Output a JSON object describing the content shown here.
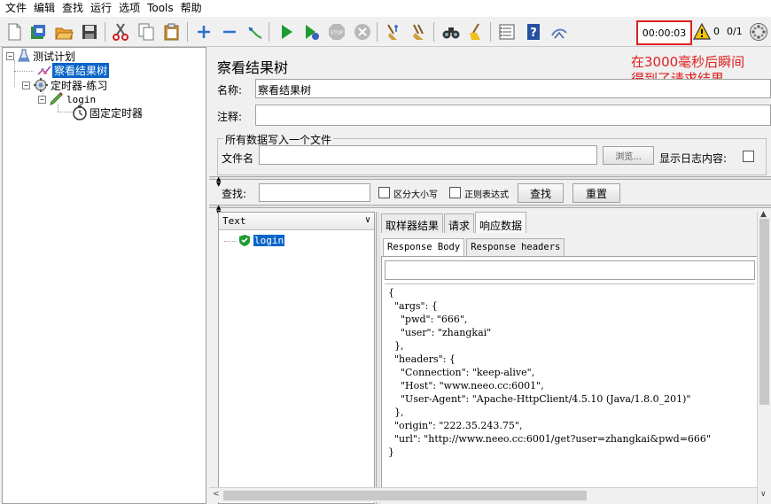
{
  "menu": [
    "文件",
    "编辑",
    "查找",
    "运行",
    "选项",
    "Tools",
    "帮助"
  ],
  "status": {
    "elapsed": "00:00:03",
    "error_count": "0",
    "threads": "0/1"
  },
  "tree": {
    "root": "测试计划",
    "listener": "察看结果树",
    "controller": "定时器-练习",
    "sampler": "login",
    "timer": "固定定时器"
  },
  "annotation": [
    "在3000毫秒后瞬间",
    "得到了请求结果"
  ],
  "panel": {
    "title": "察看结果树",
    "name_label": "名称:",
    "name_value": "察看结果树",
    "comment_label": "注释:",
    "comment_value": "",
    "file_group_title": "所有数据写入一个文件",
    "filename_label": "文件名",
    "filename_value": "",
    "browse_label": "浏览...",
    "log_label": "显示日志内容:",
    "search_label": "查找:",
    "search_value": "",
    "case_label": "区分大小写",
    "regex_label": "正则表达式",
    "find_button": "查找",
    "reset_button": "重置"
  },
  "results": {
    "renderer": "Text",
    "items": [
      "login"
    ]
  },
  "tabs": [
    "取样器结果",
    "请求",
    "响应数据"
  ],
  "subtabs": [
    "Response Body",
    "Response headers"
  ],
  "response_body": "{\n  \"args\": {\n    \"pwd\": \"666\",\n    \"user\": \"zhangkai\"\n  },\n  \"headers\": {\n    \"Connection\": \"keep-alive\",\n    \"Host\": \"www.neeo.cc:6001\",\n    \"User-Agent\": \"Apache-HttpClient/4.5.10 (Java/1.8.0_201)\"\n  },\n  \"origin\": \"222.35.243.75\",\n  \"url\": \"http://www.neeo.cc:6001/get?user=zhangkai&pwd=666\"\n}",
  "colors": {
    "selection": "#0a64c8",
    "annotation": "#e02020",
    "run": "#1f9a2e"
  }
}
